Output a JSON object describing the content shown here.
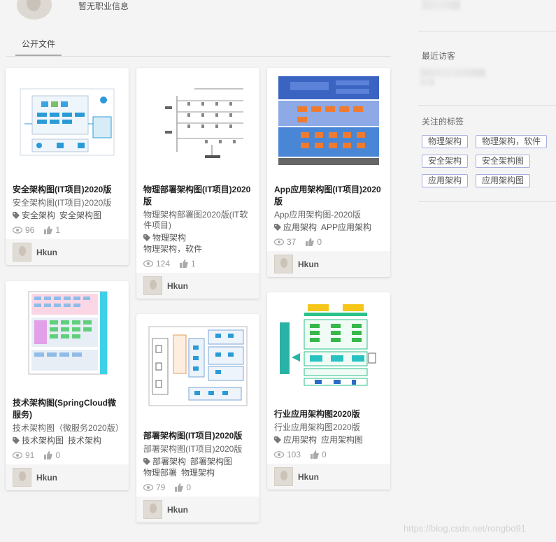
{
  "profile": {
    "job": "暂无职业信息"
  },
  "tabs": {
    "public_files": "公开文件"
  },
  "cards": [
    {
      "title": "安全架构图(IT项目)2020版",
      "subtitle": "安全架构图(IT项目)2020版",
      "tags": [
        "安全架构",
        "安全架构图"
      ],
      "views": "96",
      "likes": "1",
      "author": "Hkun"
    },
    {
      "title": "物理部署架构图(IT项目)2020版",
      "subtitle": "物理架构部署图2020版(IT软件项目)",
      "tags": [
        "物理架构",
        "物理架构，软件"
      ],
      "views": "124",
      "likes": "1",
      "author": "Hkun"
    },
    {
      "title": "App应用架构图(IT项目)2020版",
      "subtitle": "App应用架构图-2020版",
      "tags": [
        "应用架构",
        "APP应用架构"
      ],
      "views": "37",
      "likes": "0",
      "author": "Hkun"
    },
    {
      "title": "技术架构图(SpringCloud微服务)",
      "subtitle": "技术架构图（微服务2020版）",
      "tags": [
        "技术架构图",
        "技术架构"
      ],
      "views": "91",
      "likes": "0",
      "author": "Hkun"
    },
    {
      "title": "部署架构图(IT项目)2020版",
      "subtitle": "部署架构图(IT项目)2020版",
      "tags": [
        "部署架构",
        "部署架构图",
        "物理部署",
        "物理架构"
      ],
      "views": "79",
      "likes": "0",
      "author": "Hkun"
    },
    {
      "title": "行业应用架构图2020版",
      "subtitle": "行业应用架构图2020版",
      "tags": [
        "应用架构",
        "应用架构图"
      ],
      "views": "103",
      "likes": "0",
      "author": "Hkun"
    }
  ],
  "sidebar": {
    "recent_visitors": "最近访客",
    "followed_tags": "关注的标签",
    "tags": [
      "物理架构",
      "物理架构，软件",
      "安全架构",
      "安全架构图",
      "应用架构",
      "应用架构图"
    ]
  },
  "watermark": "https://blog.csdn.net/rongbo91",
  "colors": {
    "tag_border": "#a7aedd",
    "accent": "#4a6fc7",
    "background": "#f4f4f4"
  }
}
